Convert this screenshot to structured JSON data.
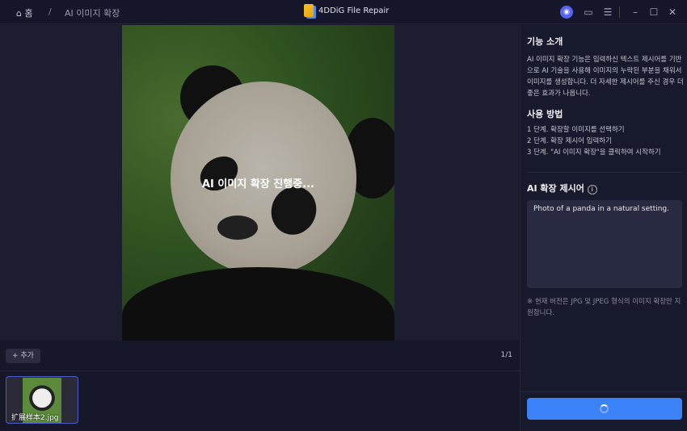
{
  "titlebar": {
    "home_label": "홈",
    "separator": "/",
    "breadcrumb": "AI 이미지 확장",
    "app_title": "4DDiG File Repair",
    "icons": [
      "home-icon",
      "app-logo-icon",
      "discord-icon",
      "feedback-icon",
      "menu-icon",
      "minimize-icon",
      "maximize-icon",
      "close-icon"
    ]
  },
  "main": {
    "progress_text": "AI 이미지 확장 진행중...",
    "add_button": "+ 추가",
    "page_indicator": "1/1",
    "thumbnails": [
      {
        "filename": "扩展样本2.jpg",
        "selected": true
      }
    ]
  },
  "sidebar": {
    "intro_title": "기능 소개",
    "intro_text": "AI 이미지 확장 기능은 입력하신 텍스트 제시어를 기반으로 AI 기술을 사용해 이미지의 누락된 부분을 채워서 이미지를 생성합니다. 더 자세한 제시어를 주신 경우 더 좋은 효과가 나옵니다.",
    "usage_title": "사용 방법",
    "steps": [
      "1 단계. 확장할 이미지를 선택하기",
      "2 단계. 확장 제시어 입력하기",
      "3 단계. \"AI 이미지 확장\"을 클릭하여 시작하기"
    ],
    "prompt_title": "AI 확장 제시어",
    "prompt_value": "Photo of a panda in a natural setting.",
    "note": "※ 현재 버전은 JPG 및 JPEG 형식의 이미지 확장만 지원합니다.",
    "button_state": "loading"
  },
  "colors": {
    "accent": "#3b82f6",
    "background": "#17172a",
    "panel": "#272a40"
  }
}
